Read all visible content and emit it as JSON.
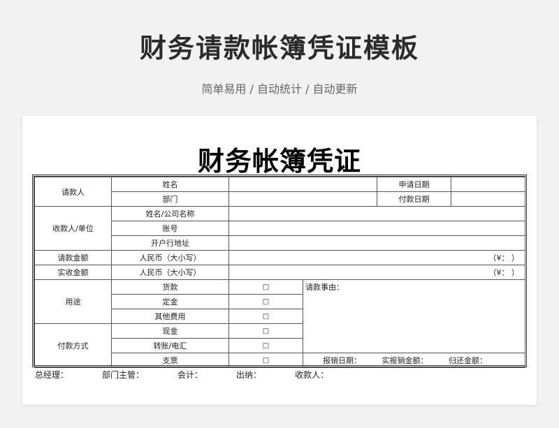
{
  "header": {
    "title": "财务请款帐簿凭证模板",
    "subtitle": "简单易用 / 自动统计 / 自动更新"
  },
  "document": {
    "title": "财务帐簿凭证"
  },
  "form": {
    "requester": {
      "label": "请款人",
      "name_label": "姓名",
      "dept_label": "部门",
      "apply_date_label": "申请日期",
      "pay_date_label": "付款日期"
    },
    "payee": {
      "label": "收款人/单位",
      "name_label": "姓名/公司名称",
      "account_label": "账号",
      "bank_label": "开户行地址"
    },
    "request_amount": {
      "label": "请款金额",
      "rmb_label": "人民币（大小写）",
      "yen_text": "（¥：        ）"
    },
    "actual_amount": {
      "label": "实收金额",
      "rmb_label": "人民币（大小写）",
      "yen_text": "（¥：        ）"
    },
    "purpose": {
      "label": "用途",
      "options": [
        "货款",
        "定金",
        "其他费用"
      ]
    },
    "payment_method": {
      "label": "付款方式",
      "options": [
        "现金",
        "转账/电汇",
        "支票"
      ]
    },
    "checkbox_symbol": "□",
    "reason_label": "请款事由：",
    "reimburse_date_label": "报销日期：",
    "actual_reimburse_label": "实报销金额：",
    "return_amount_label": "归还金额："
  },
  "signatures": {
    "gm": "总经理：",
    "dept_head": "部门主管：",
    "accountant": "会计：",
    "cashier": "出纳：",
    "receiver": "收款人："
  }
}
